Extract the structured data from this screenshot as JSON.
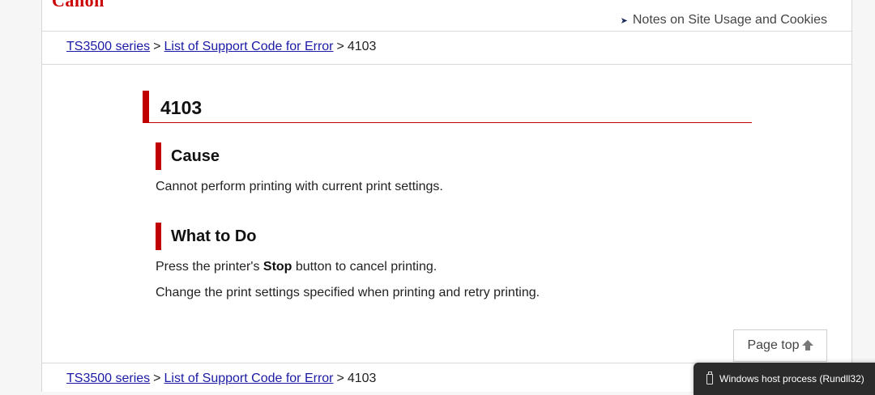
{
  "header": {
    "logo": "Canon",
    "notes_link": "Notes on Site Usage and Cookies"
  },
  "breadcrumb": {
    "items": [
      {
        "label": "TS3500 series"
      },
      {
        "label": "List of Support Code for Error"
      }
    ],
    "current": "4103",
    "separator": ">"
  },
  "main": {
    "title": "4103",
    "cause_heading": "Cause",
    "cause_text": "Cannot perform printing with current print settings.",
    "whattodo_heading": "What to Do",
    "step1_prefix": "Press the printer's ",
    "step1_bold": "Stop",
    "step1_suffix": " button to cancel printing.",
    "step2": "Change the print settings specified when printing and retry printing."
  },
  "page_top": {
    "label": "Page top"
  },
  "toast": {
    "text": "Windows host process (Rundll32)"
  },
  "colors": {
    "accent": "#c00000",
    "link": "#1a1aa6"
  }
}
